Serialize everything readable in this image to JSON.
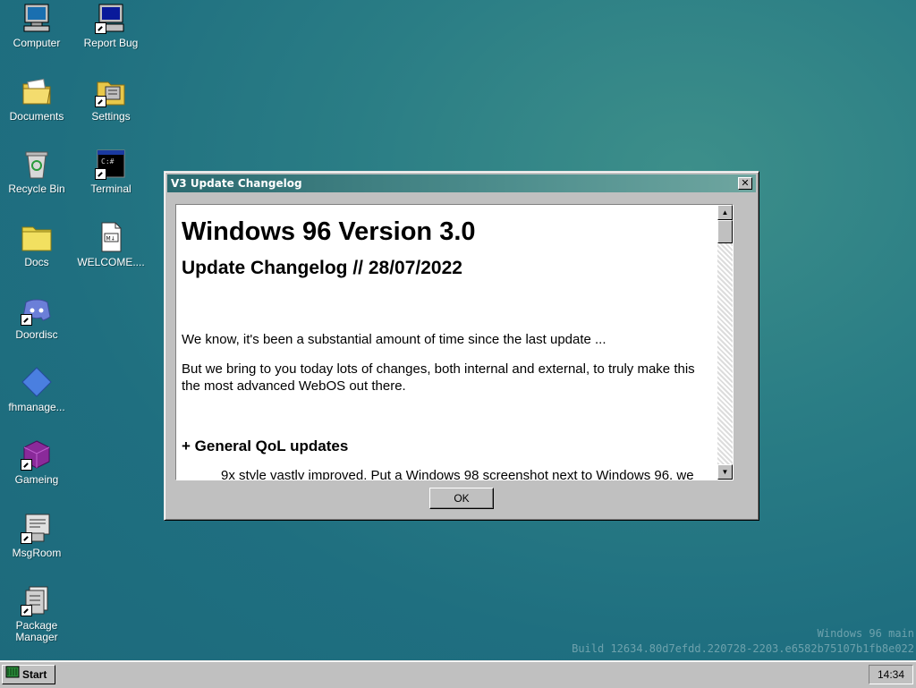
{
  "desktop": {
    "icons": [
      {
        "label": "Computer"
      },
      {
        "label": "Report Bug"
      },
      {
        "label": "Documents"
      },
      {
        "label": "Settings"
      },
      {
        "label": "Recycle Bin"
      },
      {
        "label": "Terminal"
      },
      {
        "label": "Docs"
      },
      {
        "label": "WELCOME...."
      },
      {
        "label": "Doordisc"
      },
      {
        "label": "fhmanage..."
      },
      {
        "label": "Gameing"
      },
      {
        "label": "MsgRoom"
      },
      {
        "label": "Package Manager"
      }
    ]
  },
  "window": {
    "title": "V3 Update Changelog",
    "close_glyph": "✕",
    "heading": "Windows 96 Version 3.0",
    "subheading": "Update Changelog // 28/07/2022",
    "para1": "We know, it's been a substantial amount of time since the last update ...",
    "para2": "But we bring to you today lots of changes, both internal and external, to truly make this the most advanced WebOS out there.",
    "section1": "+ General QoL updates",
    "bullet1": "9x style vastly improved. Put a Windows 98 screenshot next to Windows 96, we",
    "ok_label": "OK",
    "scroll_up": "▲",
    "scroll_down": "▼"
  },
  "watermark": {
    "line1": "Windows 96 main",
    "line2": "Build 12634.80d7efdd.220728-2203.e6582b75107b1fb8e022"
  },
  "taskbar": {
    "start_label": "Start",
    "clock": "14:34"
  },
  "colors": {
    "titlebar": "#2a6a70",
    "desktop": "#2a7d85"
  }
}
